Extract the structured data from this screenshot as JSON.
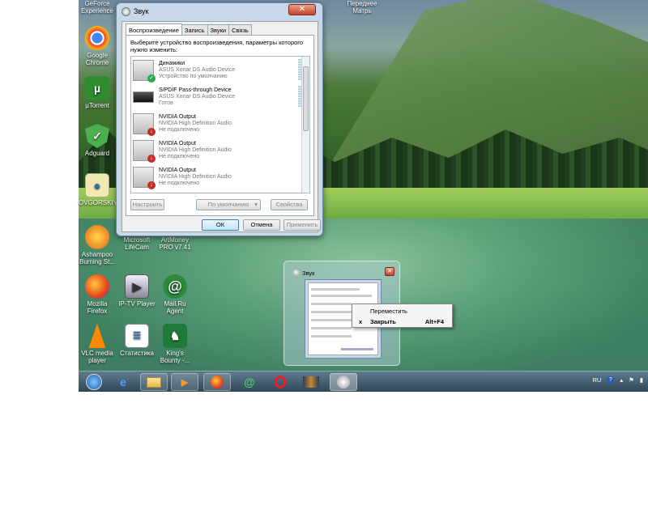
{
  "desktop": {
    "icons": [
      {
        "label": "GeForce Experience"
      },
      {
        "label": "Google Chrome"
      },
      {
        "label": "µTorrent"
      },
      {
        "label": "Adguard"
      },
      {
        "label": "OVGORSKIY"
      },
      {
        "label": "Ashampoo Burning St..."
      },
      {
        "label": "Microsoft LifeCam"
      },
      {
        "label": "ArtMoney PRO v7.41"
      },
      {
        "label": "Mozilla Firefox"
      },
      {
        "label": "IP-TV Player"
      },
      {
        "label": "Mail.Ru Agent"
      },
      {
        "label": "VLC media player"
      },
      {
        "label": "Статистика"
      },
      {
        "label": "King's Bounty -..."
      },
      {
        "label": "Переднее Матрь"
      }
    ]
  },
  "sound_window": {
    "title": "Звук",
    "close_glyph": "✕",
    "tabs": [
      {
        "label": "Воспроизведение"
      },
      {
        "label": "Запись"
      },
      {
        "label": "Звуки"
      },
      {
        "label": "Связь"
      }
    ],
    "instruction": "Выберите устройство воспроизведения, параметры которого нужно изменить:",
    "devices": [
      {
        "name": "Динамики",
        "driver": "ASUS Xonar DS Audio Device",
        "status": "Устройство по умолчанию"
      },
      {
        "name": "S/PDIF Pass-through Device",
        "driver": "ASUS Xonar DS Audio Device",
        "status": "Готов"
      },
      {
        "name": "NVIDIA Output",
        "driver": "NVIDIA High Definition Audio",
        "status": "Не подключено"
      },
      {
        "name": "NVIDIA Output",
        "driver": "NVIDIA High Definition Audio",
        "status": "Не подключено"
      },
      {
        "name": "NVIDIA Output",
        "driver": "NVIDIA High Definition Audio",
        "status": "Не подключено"
      }
    ],
    "buttons": {
      "configure": "Настроить",
      "default": "По умолчанию",
      "properties": "Свойства",
      "ok": "ОК",
      "cancel": "Отмена",
      "apply": "Применить"
    }
  },
  "taskbar_preview": {
    "title": "Звук",
    "close_glyph": "✕"
  },
  "context_menu": {
    "items": [
      {
        "label": "Переместить",
        "mark": "",
        "shortcut": ""
      },
      {
        "label": "Закрыть",
        "mark": "x",
        "shortcut": "Alt+F4"
      }
    ]
  },
  "tray": {
    "language": "RU"
  }
}
